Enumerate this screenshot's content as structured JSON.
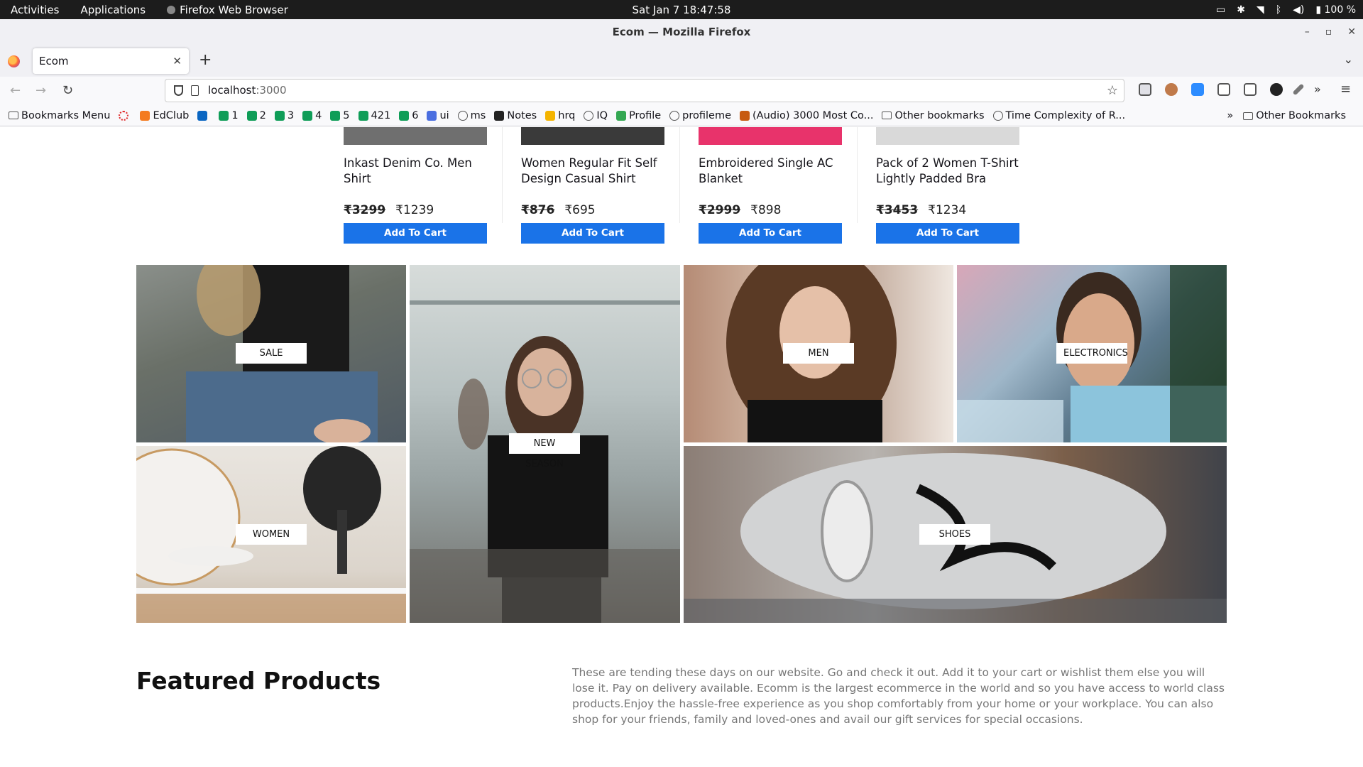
{
  "os_bar": {
    "activities": "Activities",
    "applications": "Applications",
    "app_name": "Firefox Web Browser",
    "clock": "Sat Jan 7  18:47:58",
    "battery": "100 %"
  },
  "window": {
    "title": "Ecom — Mozilla Firefox"
  },
  "tabs": [
    {
      "label": "Ecom"
    }
  ],
  "url": {
    "host": "localhost",
    "port": ":3000"
  },
  "bookmarks": [
    {
      "label": "Bookmarks Menu",
      "icon": "folder-icon",
      "color": "#555555"
    },
    {
      "label": "",
      "icon": "edclub-ring-icon",
      "color": "#e02b2b"
    },
    {
      "label": "EdClub",
      "icon": "edclub-icon",
      "color": "#f47b20"
    },
    {
      "label": "",
      "icon": "linkedin-icon",
      "color": "#0a66c2"
    },
    {
      "label": "1",
      "icon": "sheets-icon",
      "color": "#0f9d58"
    },
    {
      "label": "2",
      "icon": "sheets-icon",
      "color": "#0f9d58"
    },
    {
      "label": "3",
      "icon": "sheets-icon",
      "color": "#0f9d58"
    },
    {
      "label": "4",
      "icon": "sheets-icon",
      "color": "#0f9d58"
    },
    {
      "label": "5",
      "icon": "sheets-icon",
      "color": "#0f9d58"
    },
    {
      "label": "421",
      "icon": "sheets-icon",
      "color": "#0f9d58"
    },
    {
      "label": "6",
      "icon": "sheets-icon",
      "color": "#0f9d58"
    },
    {
      "label": "ui",
      "icon": "docs-icon",
      "color": "#4a6ee0"
    },
    {
      "label": "ms",
      "icon": "globe-icon",
      "color": "#555555"
    },
    {
      "label": "Notes",
      "icon": "notion-icon",
      "color": "#222222"
    },
    {
      "label": "hrq",
      "icon": "slides-icon",
      "color": "#f4b400"
    },
    {
      "label": "IQ",
      "icon": "globe-icon",
      "color": "#555555"
    },
    {
      "label": "Profile",
      "icon": "drive-icon",
      "color": "#34a853"
    },
    {
      "label": "profileme",
      "icon": "globe-icon",
      "color": "#555555"
    },
    {
      "label": "(Audio) 3000 Most Co...",
      "icon": "audio-icon",
      "color": "#c75b12"
    },
    {
      "label": "Other bookmarks",
      "icon": "folder-icon",
      "color": "#555555"
    },
    {
      "label": "Time Complexity of R...",
      "icon": "globe-icon",
      "color": "#555555"
    }
  ],
  "bookmarks_right": {
    "label": "Other Bookmarks"
  },
  "products": [
    {
      "name": "Inkast Denim Co. Men Shirt",
      "old_price": "₹3299",
      "price": "₹1239",
      "cta": "Add To Cart",
      "swatch": "#6f6f6f"
    },
    {
      "name": "Women Regular Fit Self Design Casual Shirt",
      "old_price": "₹876",
      "price": "₹695",
      "cta": "Add To Cart",
      "swatch": "#3a3a3a"
    },
    {
      "name": "Embroidered Single AC Blanket",
      "old_price": "₹2999",
      "price": "₹898",
      "cta": "Add To Cart",
      "swatch": "#e8336b"
    },
    {
      "name": "Pack of 2 Women T-Shirt Lightly Padded Bra",
      "old_price": "₹3453",
      "price": "₹1234",
      "cta": "Add To Cart",
      "swatch": "#d9d9d9"
    }
  ],
  "categories": [
    {
      "label": "SALE"
    },
    {
      "label": "NEW SEASON"
    },
    {
      "label": "MEN"
    },
    {
      "label": "ELECTRONICS"
    },
    {
      "label": "WOMEN"
    },
    {
      "label": "SHOES"
    }
  ],
  "featured": {
    "title": "Featured Products",
    "description": "These are tending these days on our website. Go and check it out. Add it to your cart or wishlist them else you will lose it. Pay on delivery available. Ecomm is the largest ecommerce in the world and so you have access to world class products.Enjoy the hassle-free experience as you shop comfortably from your home or your workplace. You can also shop for your friends, family and loved-ones and avail our gift services for special occasions."
  },
  "colors": {
    "accent": "#1a73e8"
  }
}
